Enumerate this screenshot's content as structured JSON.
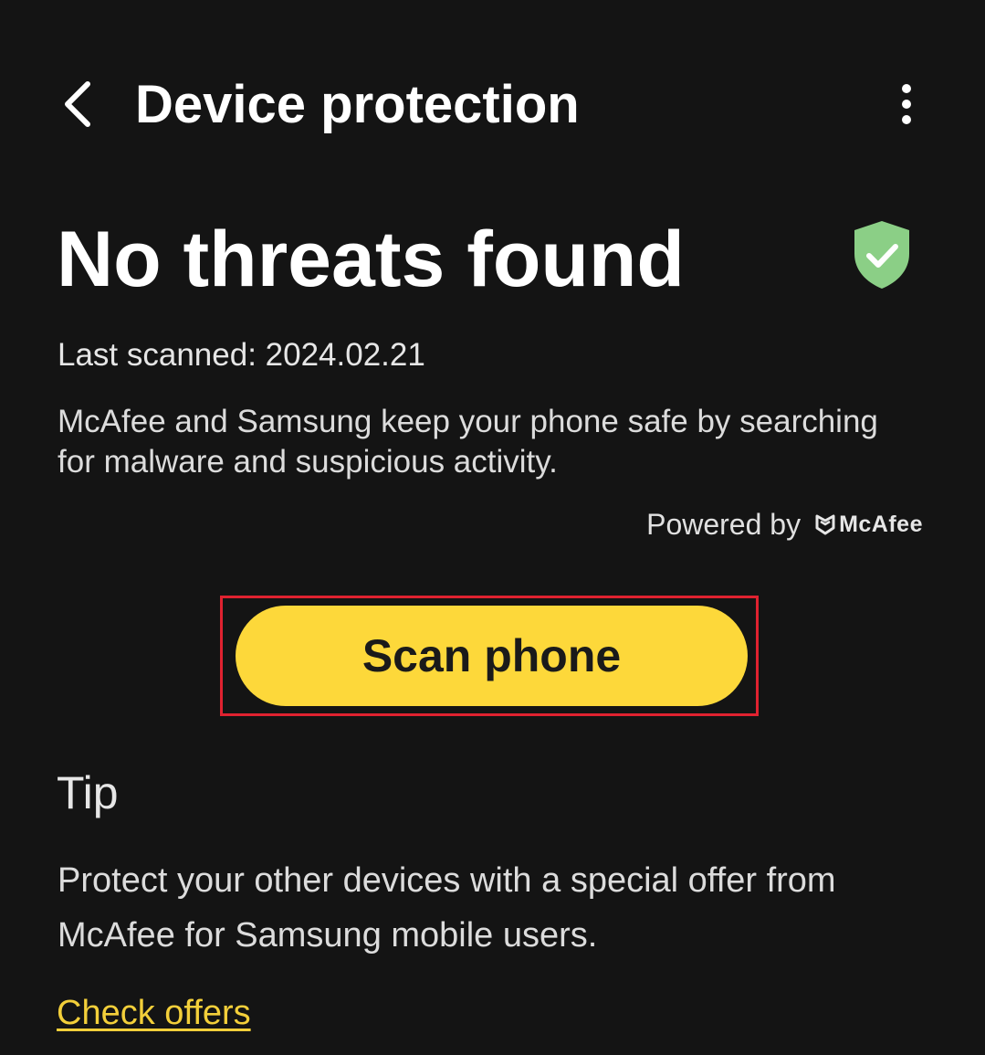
{
  "app_bar": {
    "title": "Device protection",
    "back_icon": "chevron-left-icon",
    "more_icon": "more-vertical-icon"
  },
  "status": {
    "headline": "No threats found",
    "icon": "shield-check-icon",
    "icon_color": "#8bcf86",
    "last_scanned": "Last scanned: 2024.02.21",
    "description": "McAfee and Samsung keep your phone safe by searching for malware and suspicious activity.",
    "powered_by_label": "Powered by",
    "powered_by_brand": "McAfee"
  },
  "actions": {
    "scan_button_label": "Scan phone",
    "scan_button_color": "#fdd83a",
    "highlight_color": "#e02230"
  },
  "tip": {
    "heading": "Tip",
    "body": "Protect your other devices with a special offer from McAfee for Samsung mobile users.",
    "link_label": "Check offers",
    "link_color": "#f3cf3a"
  },
  "colors": {
    "background": "#141414",
    "text": "#ffffff"
  }
}
